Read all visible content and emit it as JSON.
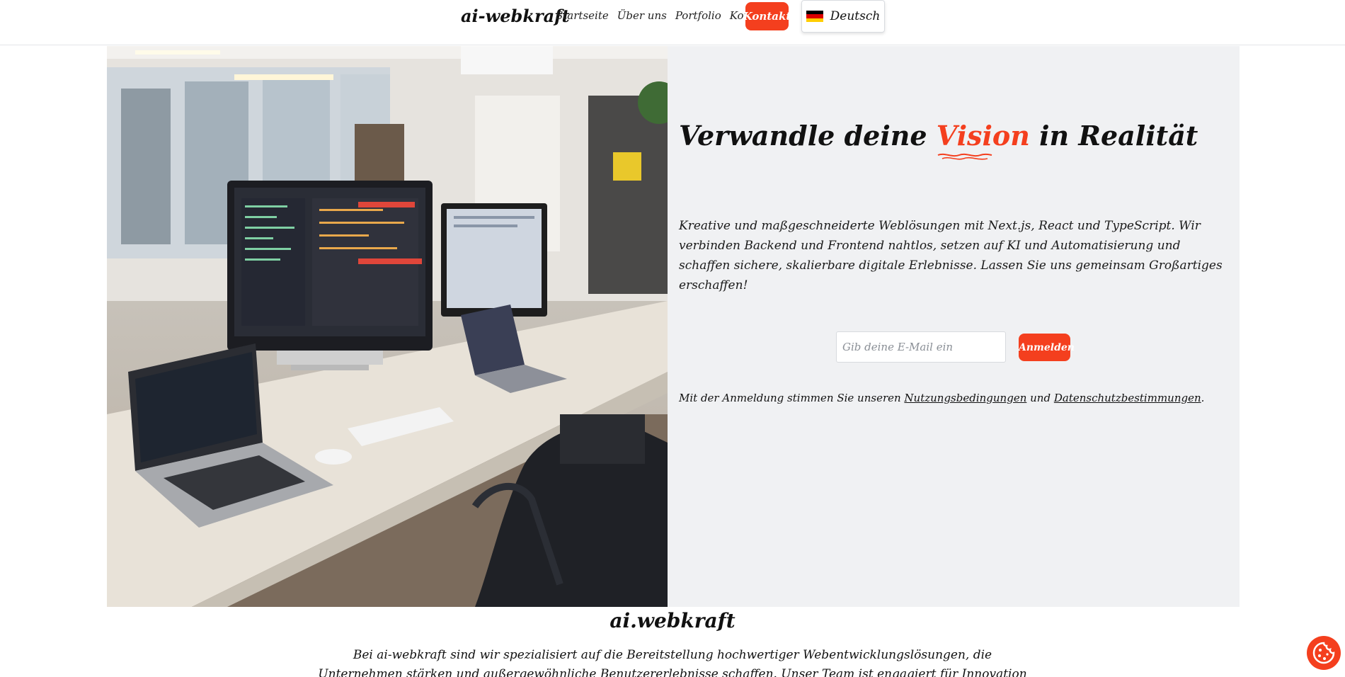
{
  "header": {
    "brand": "ai-webkraft",
    "nav": [
      "Startseite",
      "Über uns",
      "Portfolio",
      "Kontakt"
    ],
    "cta_label": "Kontakt",
    "language": "Deutsch",
    "language_flag_icon": "germany-flag-icon"
  },
  "hero": {
    "image_icon": "office-workspace-photo",
    "headline_before": "Verwandle deine ",
    "headline_accent": "Vision",
    "headline_after": " in Realität",
    "description": "Kreative und maßgeschneiderte Weblösungen mit Next.js, React und TypeScript. Wir verbinden Backend und Frontend nahtlos, setzen auf KI und Automatisierung und schaffen sichere, skalierbare digitale Erlebnisse. Lassen Sie uns gemeinsam Großartiges erschaffen!",
    "email_placeholder": "Gib deine E-Mail ein",
    "email_value": "",
    "submit_label": "Anmelden",
    "consent_prefix": "Mit der Anmeldung stimmen Sie unseren ",
    "terms_link": "Nutzungsbedingungen",
    "consent_middle": " und ",
    "privacy_link": "Datenschutzbestimmungen",
    "consent_suffix": "."
  },
  "about": {
    "title": "ai.webkraft",
    "text": "Bei ai-webkraft sind wir spezialisiert auf die Bereitstellung hochwertiger Webentwicklungslösungen, die Unternehmen stärken und außergewöhnliche Benutzererlebnisse schaffen. Unser Team ist engagiert für Innovation und Zusammenarbeit."
  },
  "cookie_button_icon": "cookie-icon",
  "colors": {
    "accent": "#f43f1e",
    "hero_background": "#f0f1f3"
  }
}
